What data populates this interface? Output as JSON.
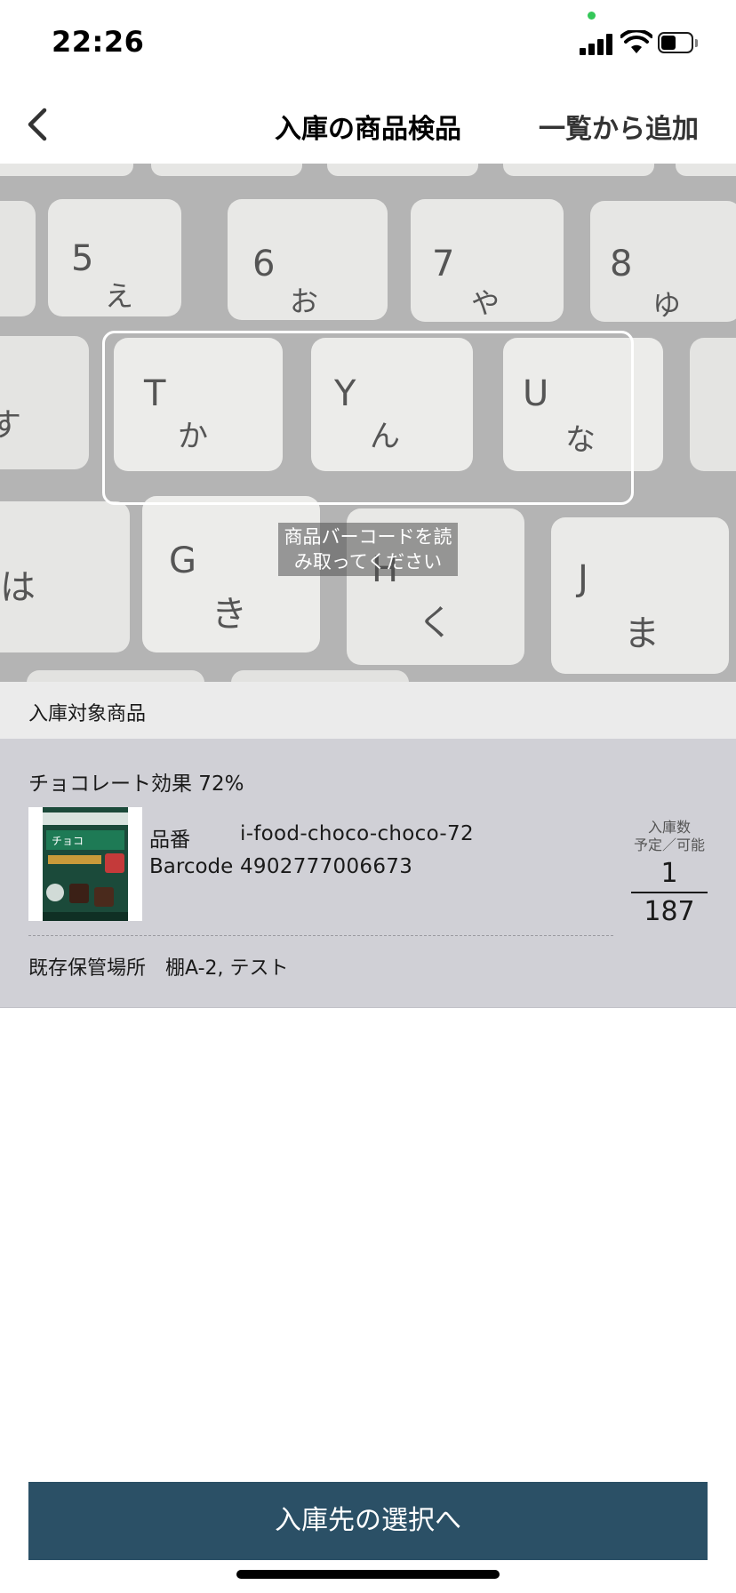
{
  "status_bar": {
    "time": "22:26",
    "icons": [
      "signal-icon",
      "wifi-icon",
      "battery-icon"
    ]
  },
  "nav": {
    "back_icon": "chevron-left-icon",
    "title": "入庫の商品検品",
    "action_label": "一覧から追加"
  },
  "scanner": {
    "hint": "商品バーコードを読み取ってください",
    "keys": [
      {
        "main": "5",
        "kana": "え"
      },
      {
        "main": "6",
        "kana": "お"
      },
      {
        "main": "7",
        "kana": "や"
      },
      {
        "main": "8",
        "kana": "ゆ"
      },
      {
        "main": "T",
        "kana": "か"
      },
      {
        "main": "Y",
        "kana": "ん"
      },
      {
        "main": "U",
        "kana": "な"
      },
      {
        "main": "G",
        "kana": "き"
      },
      {
        "main": "H",
        "kana": "く"
      },
      {
        "main": "J",
        "kana": "ま"
      },
      {
        "main": "",
        "kana": "は"
      },
      {
        "main": "",
        "kana": "す"
      }
    ]
  },
  "section": {
    "title": "入庫対象商品"
  },
  "product": {
    "name": "チョコレート効果 72%",
    "sku_label": "品番",
    "sku": "i-food-choco-choco-72",
    "barcode_label": "Barcode",
    "barcode": "4902777006673",
    "location_label": "既存保管場所",
    "location": "棚A-2, テスト",
    "quantity_title": "入庫数",
    "quantity_subtitle": "予定／可能",
    "quantity_planned": "1",
    "quantity_available": "187",
    "image_icon": "product-image-icon"
  },
  "footer": {
    "primary_button": "入庫先の選択へ"
  },
  "colors": {
    "primary_button": "#2b5066",
    "card_background": "#d0d0d6",
    "section_header_background": "#ebebeb",
    "camera_dot": "#34c759"
  }
}
